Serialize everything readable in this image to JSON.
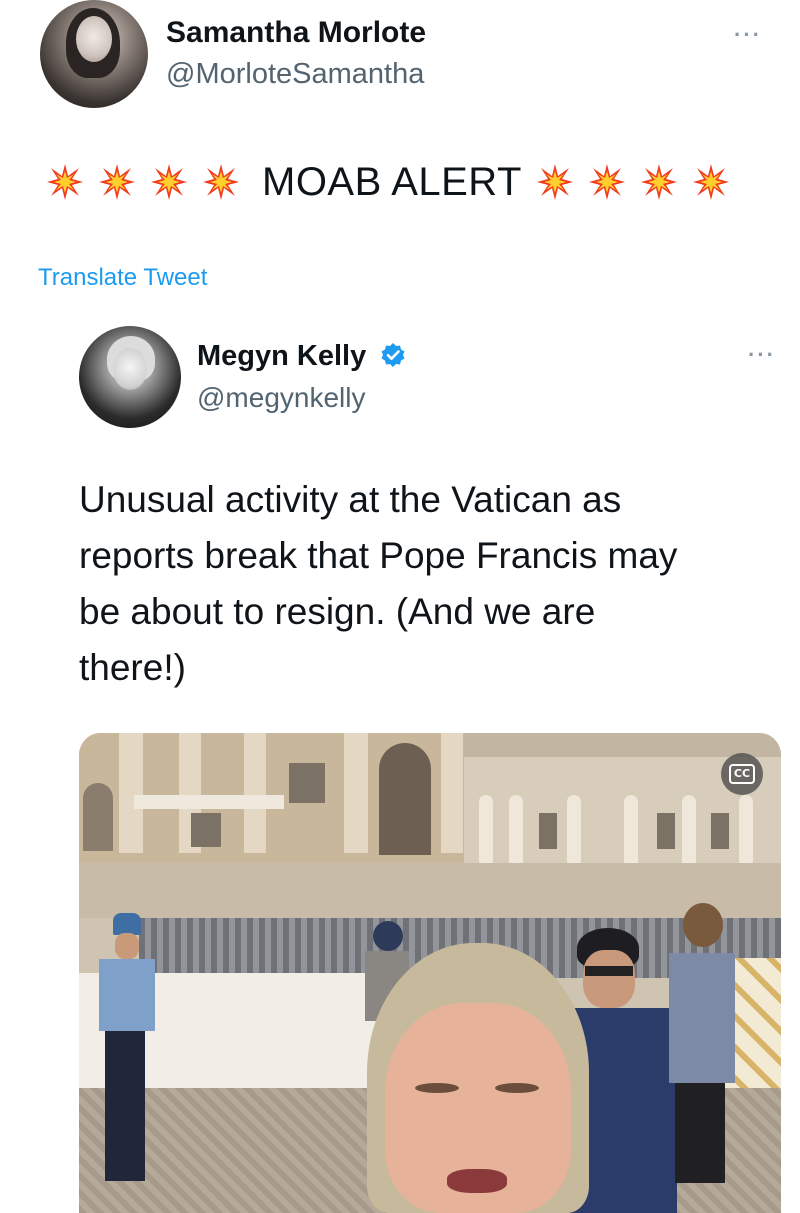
{
  "tweet": {
    "author_name": "Samantha Morlote",
    "author_handle": "@MorloteSamantha",
    "more_label": "···",
    "text": "MOAB ALERT",
    "burst_icon": "collision-emoji",
    "translate_label": "Translate Tweet"
  },
  "quoted": {
    "author_name": "Megyn Kelly",
    "author_handle": "@megynkelly",
    "verified_icon": "verified-badge-icon",
    "more_label": "···",
    "text_lines": [
      "Unusual activity at the Vatican as",
      "reports break that Pope Francis may",
      "be about to resign. (And we are",
      "there!)"
    ],
    "media": {
      "type": "video",
      "cc_label": "CC"
    }
  },
  "colors": {
    "link": "#1d9bf0",
    "verified": "#1d9bf0",
    "text": "#0f1419",
    "secondary": "#536471"
  }
}
